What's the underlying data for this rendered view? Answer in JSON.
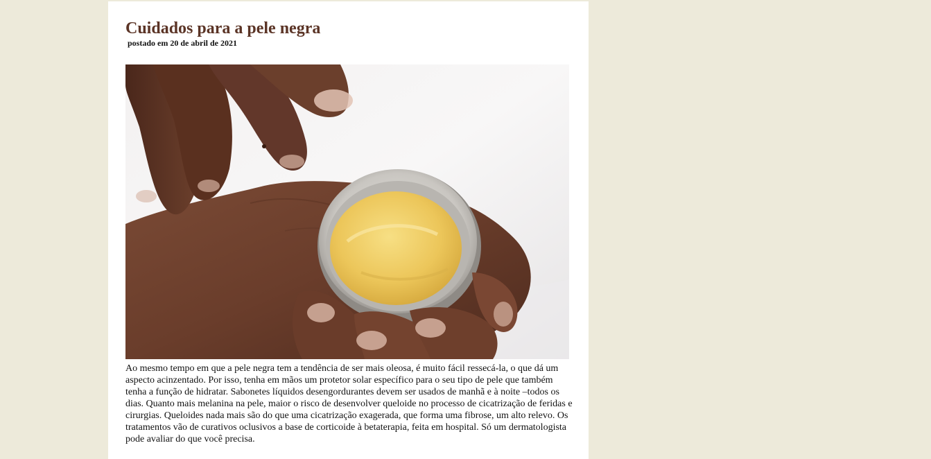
{
  "article": {
    "title": "Cuidados para a pele negra",
    "date": "postado em 20 de abril de 2021",
    "image_subject": "hands-with-balm-tin",
    "body": "Ao mesmo tempo em que a pele negra tem a tendência de ser mais oleosa, é muito fácil ressecá-la, o que dá um aspecto acinzentado. Por isso, tenha em mãos um protetor solar específico para o seu tipo de pele que também tenha a função de hidratar. Sabonetes líquidos desengordurantes devem ser usados de manhã e à noite –todos os dias. Quanto mais melanina na pele, maior o risco de desenvolver queloide no processo de cicatrização de feridas e cirurgias. Queloides nada mais são do que uma cicatrização exagerada, que forma uma fibrose, um alto relevo. Os tratamentos vão de curativos oclusivos a base de corticoide à betaterapia, feita em hospital. Só um dermatologista pode avaliar do que você precisa."
  },
  "colors": {
    "page_background": "#edeada",
    "card_background": "#ffffff",
    "title": "#5b3426",
    "text": "#111111"
  }
}
